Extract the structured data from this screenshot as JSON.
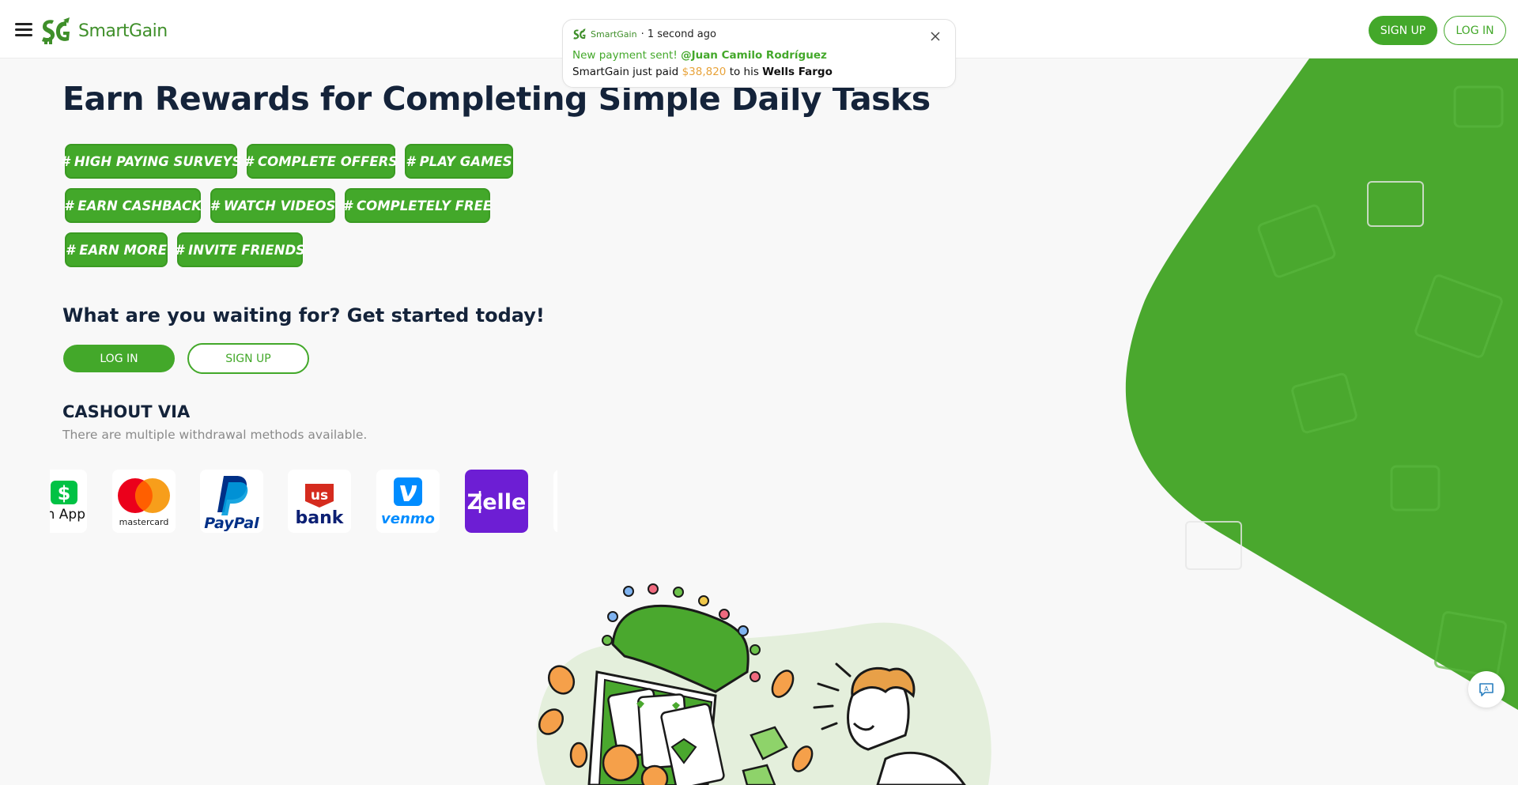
{
  "header": {
    "brand": "SmartGain",
    "signup_label": "SIGN UP",
    "login_label": "LOG IN"
  },
  "notification": {
    "brand": "SmartGain",
    "time": "· 1 second ago",
    "line2_prefix": "New payment sent!",
    "line2_user": "@Juan Camilo Rodríguez",
    "line3_prefix": "SmartGain just paid",
    "amount": "$38,820",
    "line3_mid": "to his",
    "bank": "Wells Fargo"
  },
  "hero": {
    "title": "Earn Rewards for Completing Simple Daily Tasks",
    "tags": [
      "# HIGH PAYING SURVEYS",
      "# COMPLETE OFFERS",
      "# PLAY GAMES",
      "# EARN CASHBACK",
      "# WATCH VIDEOS",
      "# COMPLETELY FREE",
      "# EARN MORE",
      "# INVITE FRIENDS"
    ]
  },
  "cta": {
    "title": "What are you waiting for? Get started today!",
    "login_label": "LOG IN",
    "signup_label": "SIGN UP"
  },
  "cashout": {
    "title": "CASHOUT VIA",
    "subtitle": "There are multiple withdrawal methods available.",
    "methods": [
      {
        "name": "Cash App",
        "visible_text": "n App"
      },
      {
        "name": "Mastercard",
        "visible_text": "mastercard"
      },
      {
        "name": "PayPal",
        "visible_text": "PayPal"
      },
      {
        "name": "US Bank",
        "visible_text": "us bank"
      },
      {
        "name": "Venmo",
        "visible_text": "venmo"
      },
      {
        "name": "Zelle",
        "visible_text": "Zelle"
      }
    ]
  },
  "colors": {
    "brand_green": "#43a82a",
    "dark_text": "#14233a",
    "amount_orange": "#e8a33a",
    "zelle_purple": "#6d1ed4",
    "venmo_blue": "#008cff",
    "paypal_navy": "#003087",
    "usbank_red": "#d52b1e"
  },
  "icons": {
    "menu": "hamburger-icon",
    "close": "close-icon",
    "chat": "translate-chat-icon"
  }
}
